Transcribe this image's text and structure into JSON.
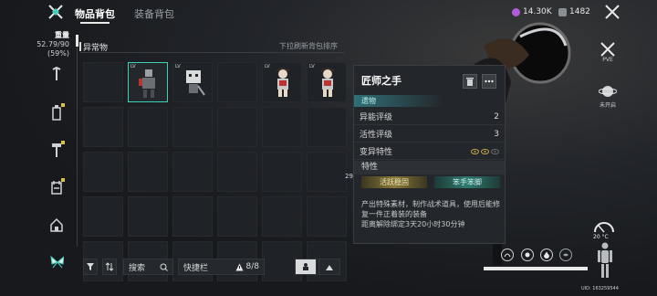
{
  "header": {
    "tabs": [
      {
        "label": "物品背包",
        "active": true
      },
      {
        "label": "装备背包",
        "active": false
      }
    ],
    "currency_primary": "14.30K",
    "currency_secondary": "1482"
  },
  "sidebar": {
    "weight_title": "重量",
    "weight_value": "52.79/90",
    "weight_percent": "(59%)",
    "weight_fraction": 0.59,
    "icons": [
      "wrench-icon",
      "bottle-icon",
      "hammer-icon",
      "calendar-icon",
      "home-icon",
      "butterfly-icon"
    ]
  },
  "inventory": {
    "section_title": "异常物",
    "sort_hint": "下拉刷新背包排序",
    "side_number": "29",
    "rows": 5,
    "cols": 6,
    "items": [
      {
        "slot": 1,
        "level": "LV",
        "icon": "robot-figure-icon",
        "selected": true
      },
      {
        "slot": 2,
        "level": "LV",
        "icon": "box-robot-icon",
        "selected": false
      },
      {
        "slot": 4,
        "level": "LV",
        "icon": "doll-figure-icon",
        "selected": false
      },
      {
        "slot": 5,
        "level": "LV",
        "icon": "doll-figure-icon",
        "selected": false
      }
    ]
  },
  "toolbar": {
    "search_label": "搜索",
    "quick_label": "快捷栏",
    "quick_count": "8/8"
  },
  "detail": {
    "title": "匠师之手",
    "category": "遗物",
    "rows": [
      {
        "label": "异能评级",
        "value": "2"
      },
      {
        "label": "活性评级",
        "value": "3"
      },
      {
        "label": "变异特性",
        "value": ""
      }
    ],
    "traits_title": "特性",
    "tags": [
      "活跃稳固",
      "笨手笨脚"
    ],
    "description": "产出特殊素材，制作战术道具，使用后能修复一件正着装的装备",
    "unbind_text": "距离解除绑定3天20小时30分钟"
  },
  "right": {
    "pve_label": "PVE",
    "off_label": "未开启",
    "temperature": "20 °C",
    "uid": "UID: 163259544"
  },
  "colors": {
    "accent": "#3fd0b8",
    "currency_gem": "#b05cd8",
    "tag_gold": "#8a7a3a",
    "tag_teal": "#2f7a70"
  }
}
